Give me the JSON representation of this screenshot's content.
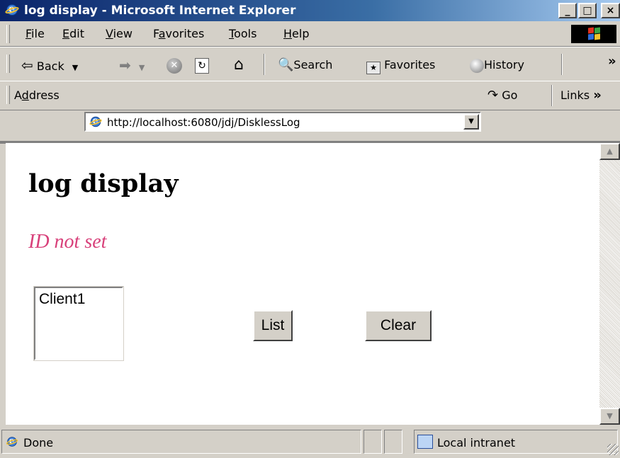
{
  "window": {
    "title": "log display - Microsoft Internet Explorer",
    "controls": {
      "minimize": "_",
      "maximize": "□",
      "close": "×"
    }
  },
  "menu": {
    "items": [
      {
        "hotkey": "F",
        "rest": "ile"
      },
      {
        "hotkey": "E",
        "rest": "dit"
      },
      {
        "hotkey": "V",
        "rest": "iew"
      },
      {
        "pre": "F",
        "hotkey": "a",
        "rest": "vorites"
      },
      {
        "hotkey": "T",
        "rest": "ools"
      },
      {
        "hotkey": "H",
        "rest": "elp"
      }
    ]
  },
  "toolbar": {
    "back_label": "Back",
    "search_label": "Search",
    "favorites_label": "Favorites",
    "history_label": "History",
    "more_glyph": "»"
  },
  "address_bar": {
    "label_pre": "A",
    "label_hotkey": "d",
    "label_rest": "dress",
    "url": "http://localhost:6080/jdj/DisklessLog",
    "go_label": "Go",
    "links_label": "Links",
    "links_more": "»"
  },
  "page": {
    "heading": "log display",
    "status_message": "ID not set",
    "client_list": [
      "Client1"
    ],
    "list_button": "List",
    "clear_button": "Clear"
  },
  "status_bar": {
    "text": "Done",
    "zone": "Local intranet"
  },
  "colors": {
    "titlebar_start": "#0a246a",
    "titlebar_end": "#a6caf0",
    "chrome": "#d4d0c8",
    "status_message": "#d8407a"
  }
}
